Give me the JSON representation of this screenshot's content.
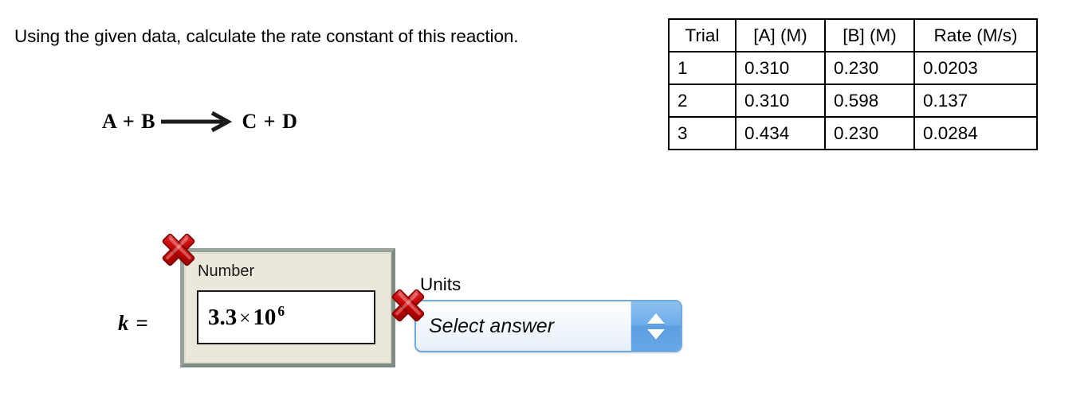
{
  "question": {
    "text": "Using the given data, calculate the rate constant of this reaction."
  },
  "equation": {
    "left": "A + B",
    "arrow": "right-arrow-icon",
    "right": "C + D"
  },
  "table": {
    "headers": [
      "Trial",
      "[A] (M)",
      "[B] (M)",
      "Rate (M/s)"
    ],
    "rows": [
      {
        "trial": "1",
        "a": "0.310",
        "b": "0.230",
        "rate": "0.0203"
      },
      {
        "trial": "2",
        "a": "0.310",
        "b": "0.598",
        "rate": "0.137"
      },
      {
        "trial": "3",
        "a": "0.434",
        "b": "0.230",
        "rate": "0.0284"
      }
    ]
  },
  "answer": {
    "k_label": "k =",
    "number_label": "Number",
    "number_value_mantissa": "3.3",
    "number_value_times": "×",
    "number_value_base": "10",
    "number_value_exponent": "6",
    "units_label": "Units",
    "units_placeholder": "Select answer",
    "spinner_up_icon": "triangle-up-icon",
    "spinner_down_icon": "triangle-down-icon"
  },
  "marks": {
    "number_incorrect_icon": "red-x-icon",
    "units_incorrect_icon": "red-x-icon"
  },
  "colors": {
    "panel_fill": "#e9e8da",
    "panel_border": "#8d9a93",
    "select_border": "#73a8da",
    "spinner_blue": "#6fadea",
    "x_red": "#c00000",
    "text": "#000000"
  }
}
